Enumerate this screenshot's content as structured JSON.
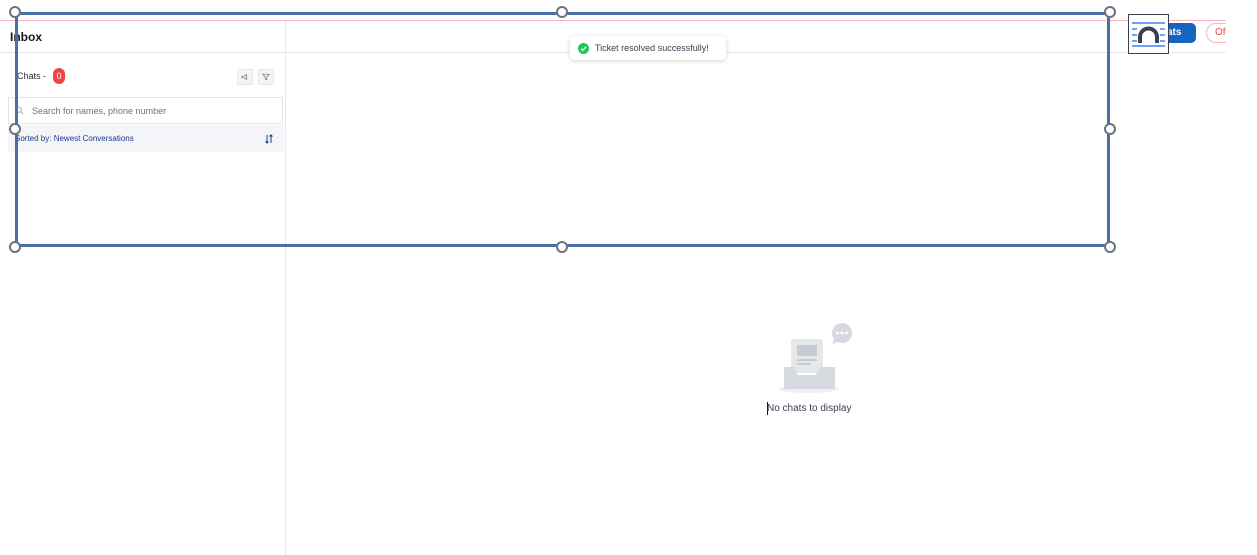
{
  "header": {
    "title": "Inbox"
  },
  "chats": {
    "label": "Chats -",
    "count": "0"
  },
  "search": {
    "placeholder": "Search for names, phone number"
  },
  "sort": {
    "label": "Sorted by: Newest Conversations"
  },
  "toast": {
    "message": "Ticket resolved successfully!"
  },
  "empty_state": {
    "message": "No chats to display"
  },
  "topbar": {
    "chats_button_label": "ats",
    "status_pill_label": "Of"
  },
  "colors": {
    "accent_blue": "#1565c0",
    "badge_red": "#ef4444",
    "success_green": "#22c55e",
    "selection_border": "#4a6fa5"
  },
  "icons": [
    "megaphone-icon",
    "filter-icon",
    "search-icon",
    "sort-icon",
    "check-circle-icon",
    "inbox-tray-icon",
    "chat-bubble-icon",
    "widget-icon"
  ]
}
